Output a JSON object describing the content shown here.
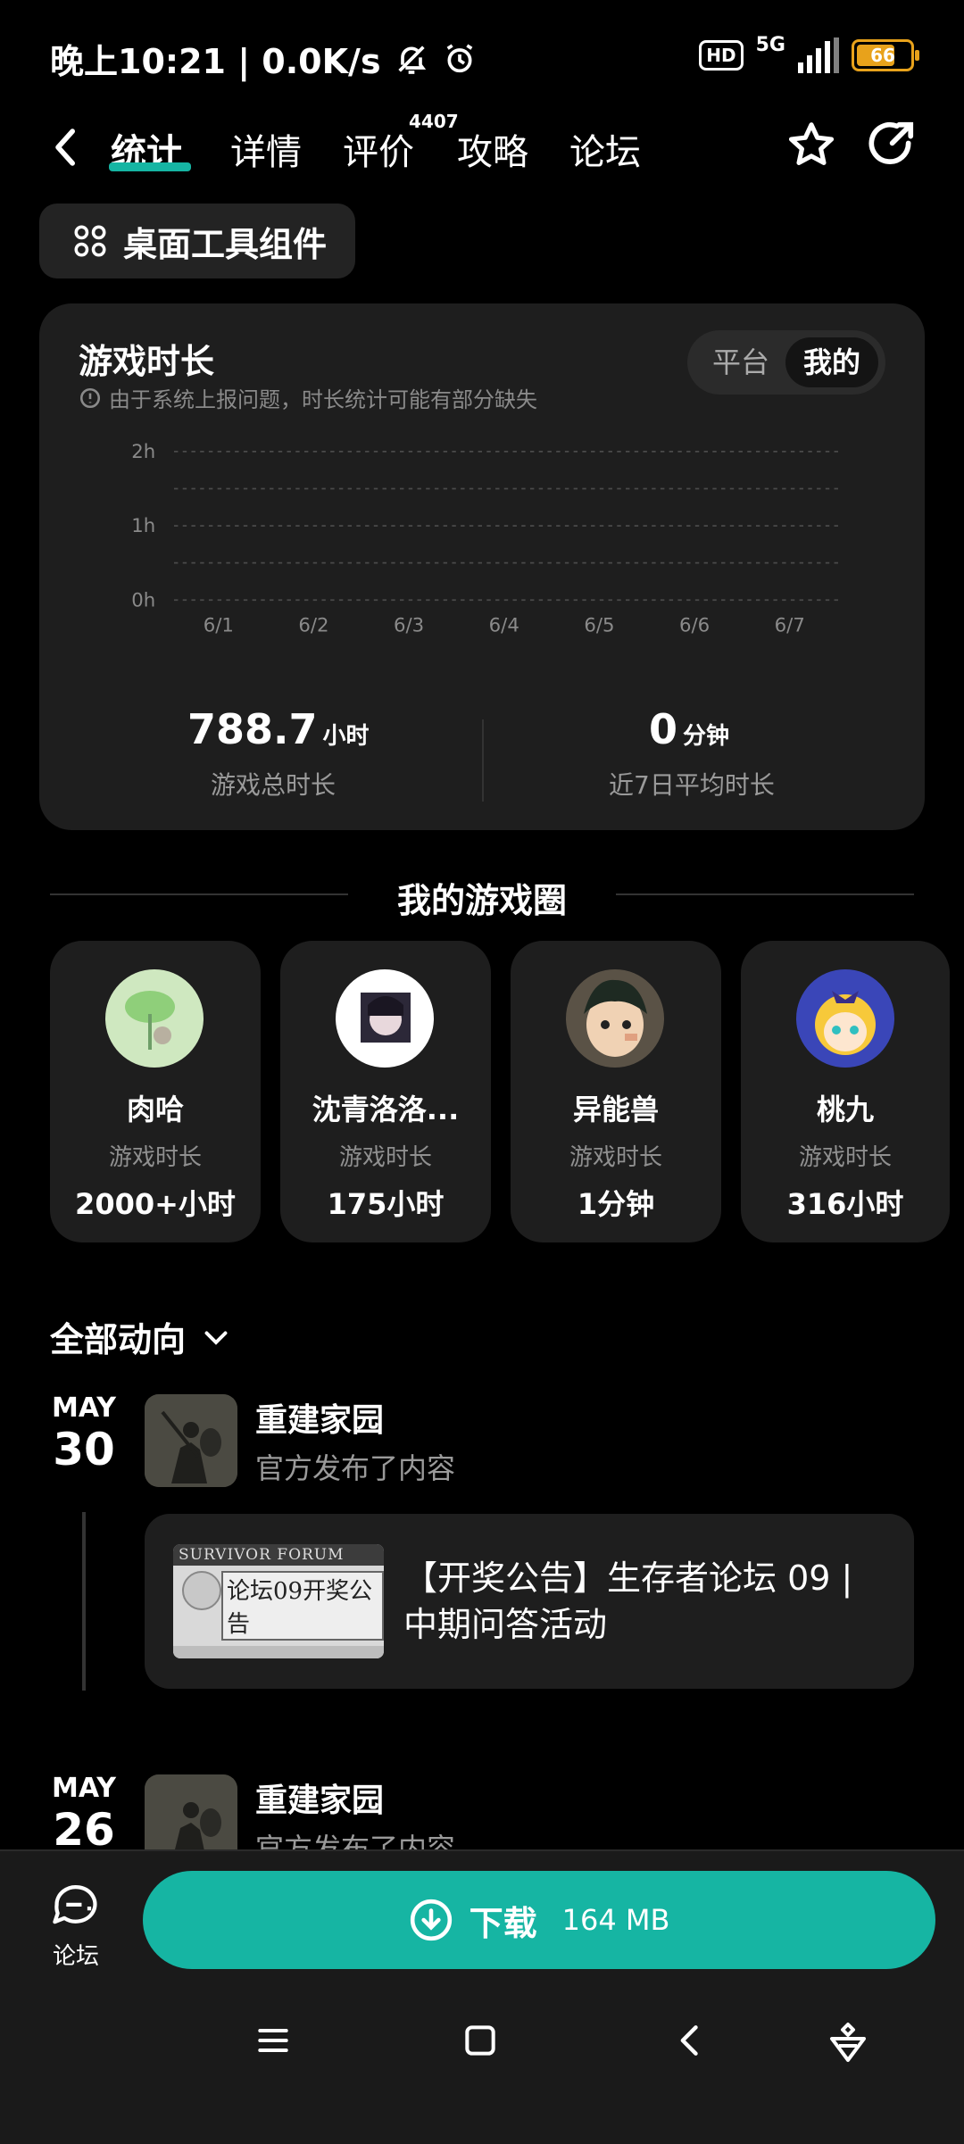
{
  "status_bar": {
    "left_text": "晚上10:21 | 0.0K/s",
    "network": "5G",
    "hd": "HD",
    "battery": "66"
  },
  "nav": {
    "tabs": [
      "统计",
      "详情",
      "评价",
      "攻略",
      "论坛"
    ],
    "active_tab": "统计",
    "review_count": "4407"
  },
  "widget_button": "桌面工具组件",
  "stats": {
    "title": "游戏时长",
    "note": "由于系统上报问题，时长统计可能有部分缺失",
    "segment": [
      "平台",
      "我的"
    ],
    "segment_selected": "我的",
    "total_value": "788.7",
    "total_unit": "小时",
    "total_label": "游戏总时长",
    "avg_value": "0",
    "avg_unit": "分钟",
    "avg_label": "近7日平均时长"
  },
  "chart_data": {
    "type": "bar",
    "categories": [
      "6/1",
      "6/2",
      "6/3",
      "6/4",
      "6/5",
      "6/6",
      "6/7"
    ],
    "values": [
      0,
      0,
      0,
      0,
      0,
      0,
      0
    ],
    "y_ticks": [
      "0h",
      "1h",
      "2h"
    ],
    "ylim": [
      0,
      2
    ],
    "grid": true,
    "title": "",
    "xlabel": "",
    "ylabel": ""
  },
  "circle": {
    "title": "我的游戏圈",
    "label": "游戏时长",
    "friends": [
      {
        "name": "肉哈",
        "value": "2000+小时"
      },
      {
        "name": "沈青洛洛...",
        "value": "175小时"
      },
      {
        "name": "异能兽",
        "value": "1分钟"
      },
      {
        "name": "桃九",
        "value": "316小时"
      }
    ]
  },
  "feed": {
    "filter": "全部动向",
    "items": [
      {
        "month": "MAY",
        "day": "30",
        "game": "重建家园",
        "action": "官方发布了内容",
        "post_title": "【开奖公告】生存者论坛 09 | 中期问答活动",
        "image_header": "SURVIVOR FORUM",
        "image_title": "论坛09开奖公告"
      },
      {
        "month": "MAY",
        "day": "26",
        "game": "重建家园",
        "action": "官方发布了内容"
      }
    ]
  },
  "bottom": {
    "forum_label": "论坛",
    "download_label": "下载",
    "download_size": "164 MB"
  },
  "colors": {
    "accent": "#16b5a3",
    "card": "#1e1e1e",
    "battery": "#e8a21b"
  }
}
